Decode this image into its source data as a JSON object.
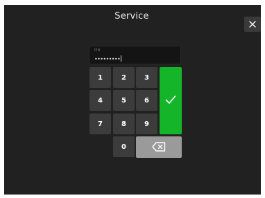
{
  "window": {
    "title": "Service"
  },
  "pin": {
    "label": "PIN",
    "value": "•••••••••"
  },
  "keypad": {
    "keys": [
      "1",
      "2",
      "3",
      "4",
      "5",
      "6",
      "7",
      "8",
      "9",
      "0"
    ]
  },
  "icons": {
    "close": "close-icon",
    "confirm": "checkmark-icon",
    "backspace": "backspace-icon"
  },
  "colors": {
    "background": "#212121",
    "key": "#3c3c3c",
    "confirm": "#15b52a",
    "backspace": "#9a9a9a"
  }
}
